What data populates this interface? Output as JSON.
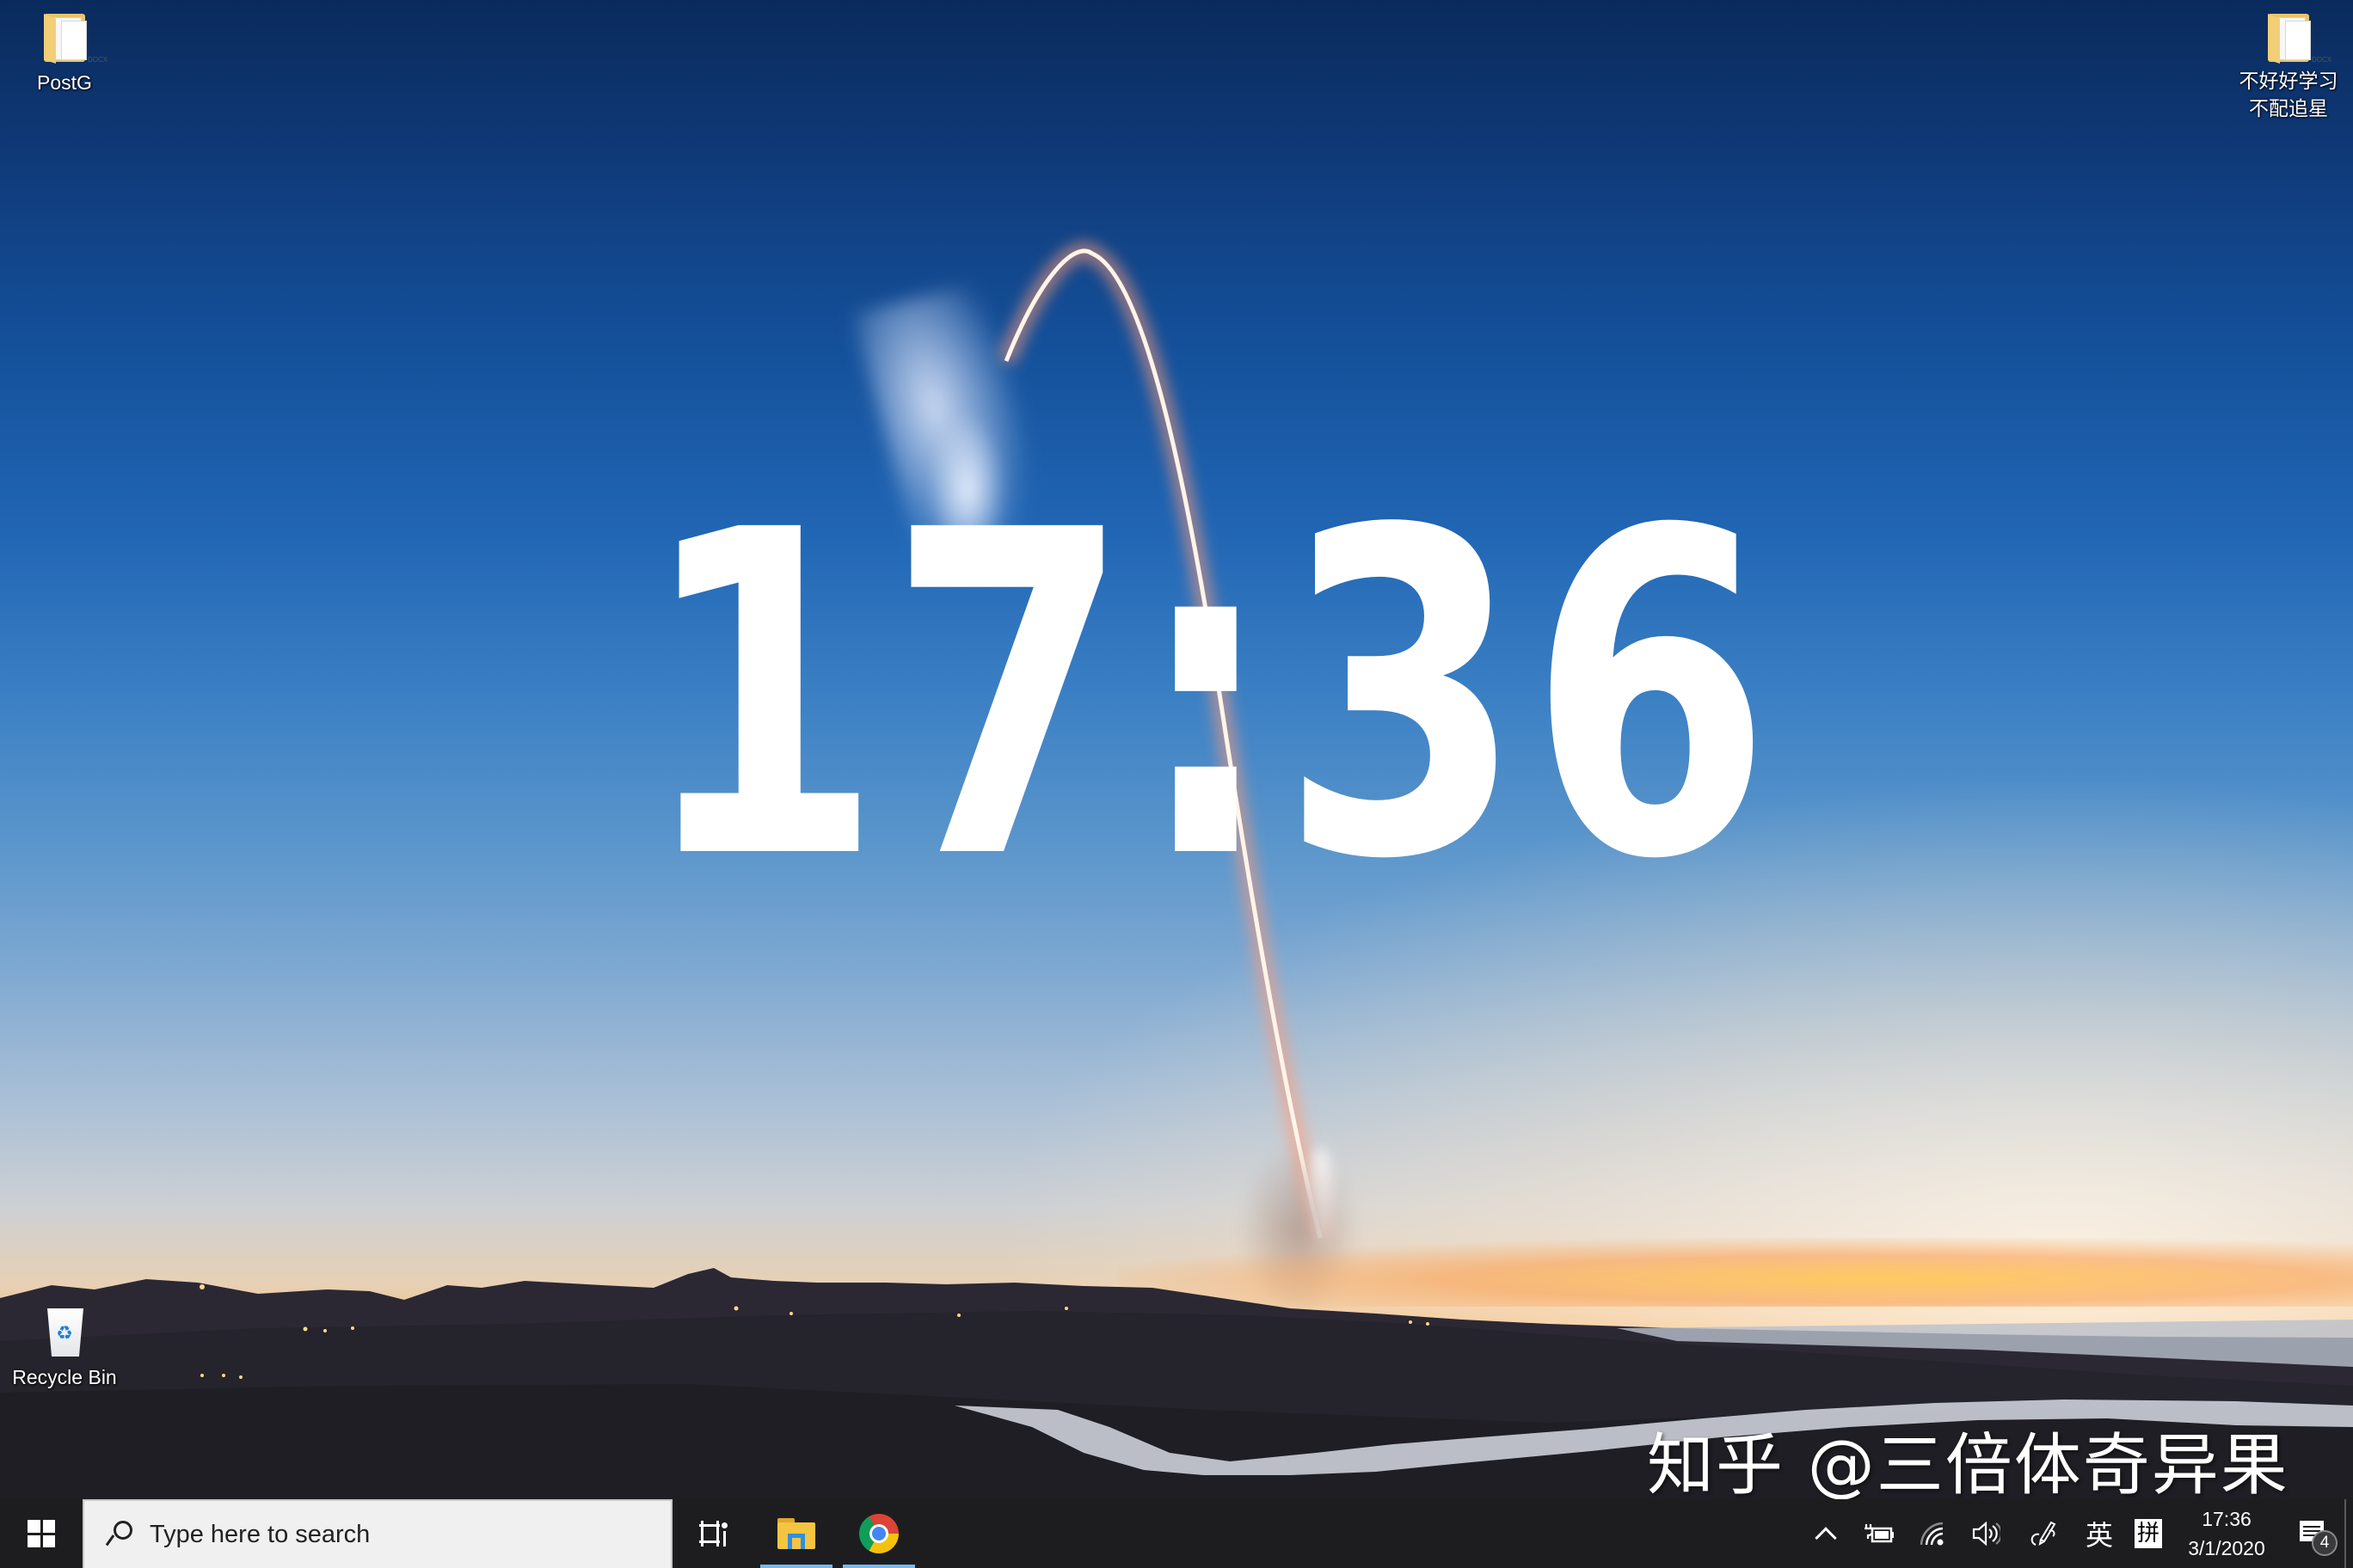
{
  "desktop": {
    "icons": [
      {
        "label": "PostG",
        "type": "folder"
      },
      {
        "label": "不好好学习\n不配追星",
        "line1": "不好好学习",
        "line2": "不配追星",
        "type": "folder"
      },
      {
        "label": "Recycle Bin",
        "type": "recycle-bin"
      }
    ],
    "big_clock": "17:36",
    "watermark": "知乎 @三倍体奇异果",
    "wallpaper": "rocket-launch-at-dusk"
  },
  "taskbar": {
    "search": {
      "placeholder": "Type here to search"
    },
    "pinned_apps": [
      {
        "name": "File Explorer",
        "icon": "folder-icon",
        "running": true
      },
      {
        "name": "Google Chrome",
        "icon": "chrome-icon",
        "running": true
      }
    ],
    "tray": {
      "show_hidden_icon": "chevron-up-icon",
      "battery_icon": "battery-charging-icon",
      "network_icon": "wifi-icon",
      "volume_icon": "volume-icon",
      "pen_icon": "windows-ink-icon",
      "ime_language": "英",
      "ime_mode": "拼",
      "time": "17:36",
      "date": "3/1/2020",
      "notification_count": "4"
    }
  },
  "colors": {
    "taskbar_bg": "#1d1d1f",
    "search_bg": "#f0f0f0",
    "running_indicator": "#76b9ed",
    "clock_text": "#ffffff"
  }
}
